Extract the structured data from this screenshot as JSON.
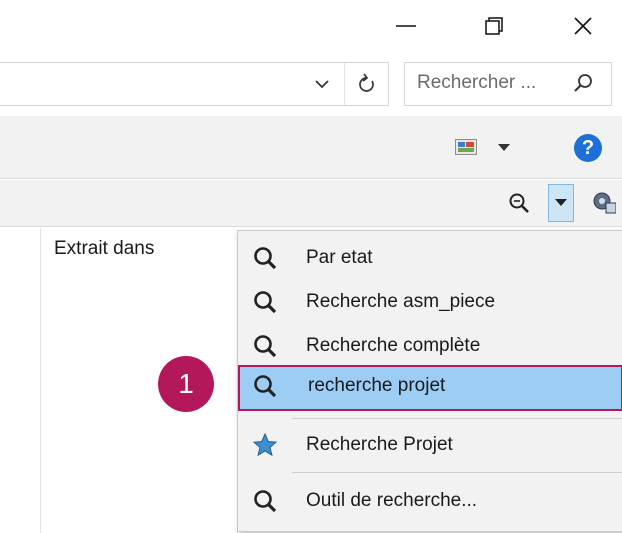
{
  "window": {
    "minimize_glyph": "—",
    "close_glyph": "✕"
  },
  "search": {
    "placeholder": "Rechercher ..."
  },
  "list": {
    "column_header": "Extrait dans"
  },
  "menu": {
    "items": [
      {
        "label": "Par etat",
        "icon": "magnifier-icon"
      },
      {
        "label": "Recherche asm_piece",
        "icon": "magnifier-icon"
      },
      {
        "label": "Recherche complète",
        "icon": "magnifier-icon"
      },
      {
        "label": "recherche projet",
        "icon": "magnifier-icon",
        "highlighted": true
      },
      {
        "label": "Recherche Projet",
        "icon": "star-icon"
      },
      {
        "label": "Outil de recherche...",
        "icon": "magnifier-icon"
      }
    ]
  },
  "callout": {
    "number": "1"
  },
  "colors": {
    "highlight_fill": "#9dcdf5",
    "highlight_border": "#b2185a",
    "callout": "#b2185a",
    "help": "#1e6fd9",
    "star": "#3d8fcf"
  }
}
